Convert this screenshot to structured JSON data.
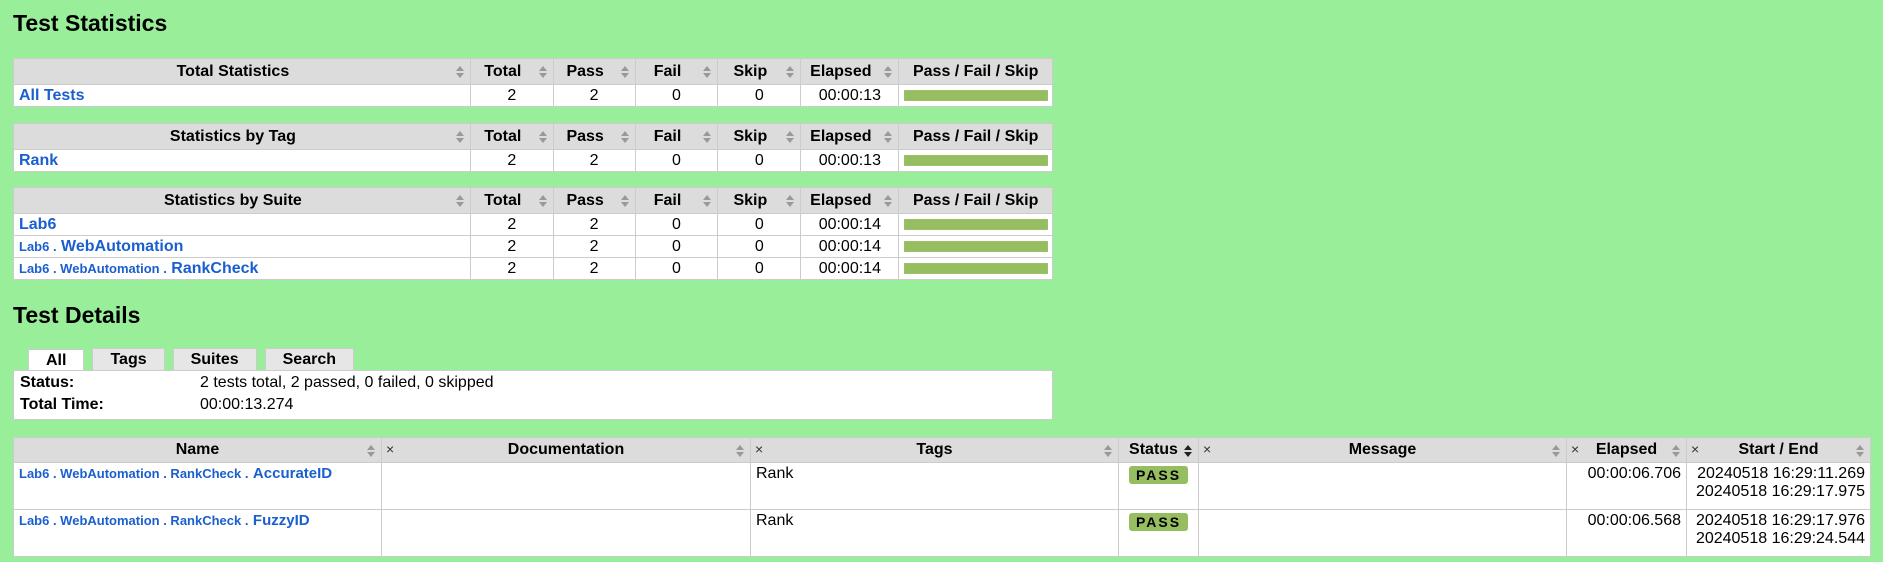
{
  "headings": {
    "stats": "Test Statistics",
    "details": "Test Details"
  },
  "stat_headers": [
    "Total",
    "Pass",
    "Fail",
    "Skip",
    "Elapsed",
    "Pass / Fail / Skip"
  ],
  "total_table": {
    "title": "Total Statistics",
    "rows": [
      {
        "name": "All Tests",
        "total": "2",
        "pass": "2",
        "fail": "0",
        "skip": "0",
        "elapsed": "00:00:13",
        "pass_ratio": 1.0
      }
    ]
  },
  "tag_table": {
    "title": "Statistics by Tag",
    "rows": [
      {
        "name": "Rank",
        "total": "2",
        "pass": "2",
        "fail": "0",
        "skip": "0",
        "elapsed": "00:00:13",
        "pass_ratio": 1.0
      }
    ]
  },
  "suite_table": {
    "title": "Statistics by Suite",
    "rows": [
      {
        "name": "Lab6",
        "total": "2",
        "pass": "2",
        "fail": "0",
        "skip": "0",
        "elapsed": "00:00:14",
        "pass_ratio": 1.0
      },
      {
        "prefix": "Lab6 .",
        "name": "WebAutomation",
        "total": "2",
        "pass": "2",
        "fail": "0",
        "skip": "0",
        "elapsed": "00:00:14",
        "pass_ratio": 1.0
      },
      {
        "prefix": "Lab6 . WebAutomation .",
        "name": "RankCheck",
        "total": "2",
        "pass": "2",
        "fail": "0",
        "skip": "0",
        "elapsed": "00:00:14",
        "pass_ratio": 1.0
      }
    ]
  },
  "tabs": [
    "All",
    "Tags",
    "Suites",
    "Search"
  ],
  "summary": {
    "status_label": "Status:",
    "status_value": "2 tests total, 2 passed, 0 failed, 0 skipped",
    "time_label": "Total Time:",
    "time_value": "00:00:13.274"
  },
  "details_headers": [
    "Name",
    "Documentation",
    "Tags",
    "Status",
    "Message",
    "Elapsed",
    "Start / End"
  ],
  "tests": [
    {
      "prefix": "Lab6 . WebAutomation . RankCheck .",
      "name": "AccurateID",
      "doc": "",
      "tags": "Rank",
      "status": "PASS",
      "message": "",
      "elapsed": "00:00:06.706",
      "start": "20240518 16:29:11.269",
      "end": "20240518 16:29:17.975"
    },
    {
      "prefix": "Lab6 . WebAutomation . RankCheck .",
      "name": "FuzzyID",
      "doc": "",
      "tags": "Rank",
      "status": "PASS",
      "message": "",
      "elapsed": "00:00:06.568",
      "start": "20240518 16:29:17.976",
      "end": "20240518 16:29:24.544"
    }
  ],
  "colors": {
    "background": "#99ee99",
    "pass": "#97bd61",
    "link": "#1a5fd0"
  }
}
